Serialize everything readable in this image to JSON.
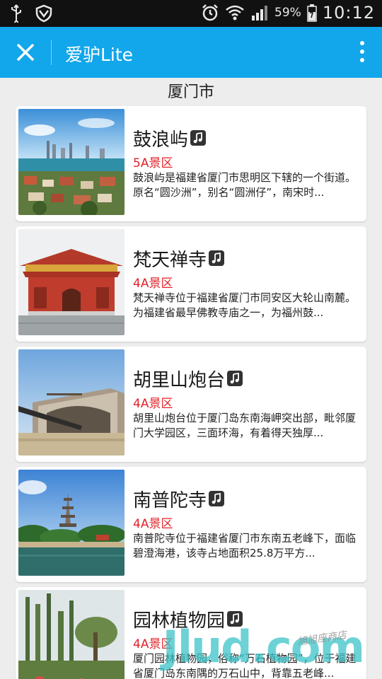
{
  "status_bar": {
    "battery_percent": "59%",
    "time": "10:12",
    "icons": [
      "usb-icon",
      "shield-icon",
      "alarm-icon",
      "wifi-icon",
      "signal-icon",
      "battery-icon"
    ]
  },
  "app_bar": {
    "title": "爱驴Lite",
    "close_icon": "close-icon",
    "more_icon": "more-vertical-icon",
    "color": "#12a6ea"
  },
  "city": "厦门市",
  "spots": [
    {
      "name": "鼓浪屿",
      "grade": "5A景区",
      "desc": "鼓浪屿是福建省厦门市思明区下辖的一个街道。原名“圆沙洲”，别名“圆洲仔”，南宋时..."
    },
    {
      "name": "梵天禅寺",
      "grade": "4A景区",
      "desc": "梵天禅寺位于福建省厦门市同安区大轮山南麓。为福建省最早佛教寺庙之一，为福州鼓..."
    },
    {
      "name": "胡里山炮台",
      "grade": "4A景区",
      "desc": "胡里山炮台位于厦门岛东南海岬突出部，毗邻厦门大学园区，三面环海，有着得天独厚..."
    },
    {
      "name": "南普陀寺",
      "grade": "4A景区",
      "desc": "南普陀寺位于福建省厦门市东南五老峰下，面临碧澄海港，该寺占地面积25.8万平方..."
    },
    {
      "name": "园林植物园",
      "grade": "4A景区",
      "desc": "厦门园林植物园，俗称“万石植物园”，位于福建省厦门岛东南隅的万石山中，背靠五老峰..."
    }
  ],
  "colors": {
    "grade": "#e0232a",
    "accent": "#12a6ea"
  },
  "watermark": {
    "text": "Jlud.com",
    "script": "旭旭座商店"
  }
}
